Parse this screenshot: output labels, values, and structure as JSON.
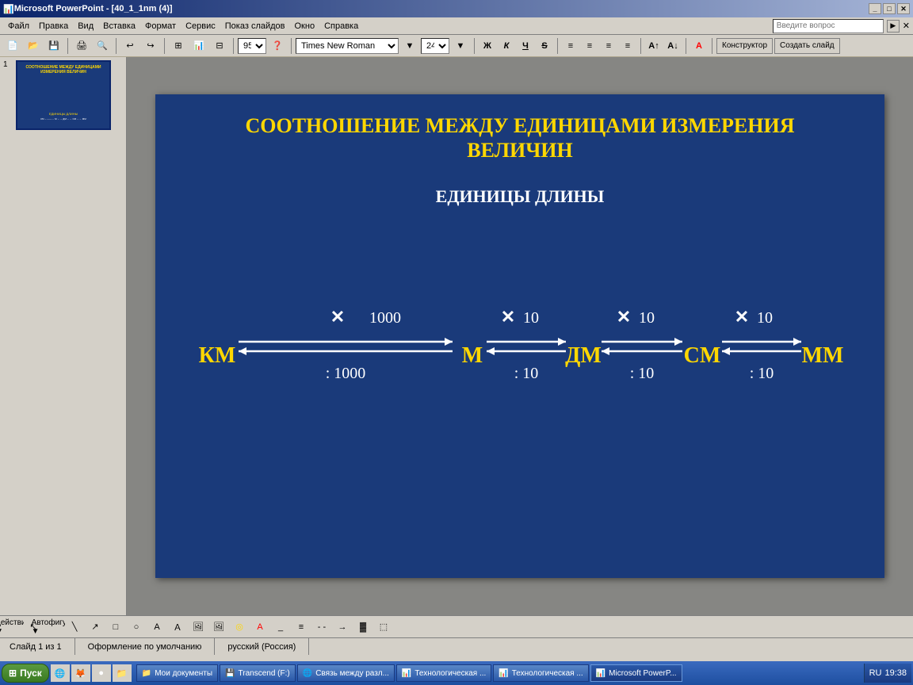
{
  "window": {
    "title": "Microsoft PowerPoint - [40_1_1nm (4)]",
    "icon": "📊"
  },
  "menu": {
    "items": [
      "Файл",
      "Правка",
      "Вид",
      "Вставка",
      "Формат",
      "Сервис",
      "Показ слайдов",
      "Окно",
      "Справка"
    ],
    "ask_placeholder": "Введите вопрос"
  },
  "toolbar1": {
    "zoom": "95%",
    "font": "Times New Roman",
    "size": "24",
    "bold": "Ж",
    "italic": "К",
    "underline": "Ч",
    "strikethrough": "S",
    "konstruktor": "Конструктор",
    "create_slide": "Создать слайд"
  },
  "slide": {
    "heading_line1": "СООТНОШЕНИЕ МЕЖДУ ЕДИНИЦАМИ ИЗМЕРЕНИЯ",
    "heading_line2": "ВЕЛИЧИН",
    "subheading": "ЕДИНИЦЫ ДЛИНЫ",
    "units": {
      "km": "КМ",
      "m": "М",
      "dm": "ДМ",
      "cm": "СМ",
      "mm": "ММ"
    },
    "multipliers": {
      "km_m": "× 1000",
      "km_m_div": ": 1000",
      "m_dm": "× 10",
      "m_dm_div": ": 10",
      "dm_cm": "× 10",
      "dm_cm_div": ": 10",
      "cm_mm": "× 10",
      "cm_mm_div": ": 10"
    }
  },
  "statusbar": {
    "slide_info": "Слайд 1 из 1",
    "design": "Оформление по умолчанию",
    "language": "русский (Россия)"
  },
  "taskbar": {
    "start": "Пуск",
    "time": "19:38",
    "lang": "RU",
    "items": [
      {
        "label": "Мои документы",
        "active": false
      },
      {
        "label": "Transcend (F:)",
        "active": false
      },
      {
        "label": "Связь между разл...",
        "active": false
      },
      {
        "label": "Технологическая ...",
        "active": false
      },
      {
        "label": "Технологическая ...",
        "active": false
      },
      {
        "label": "Microsoft PowerP...",
        "active": true
      }
    ]
  }
}
